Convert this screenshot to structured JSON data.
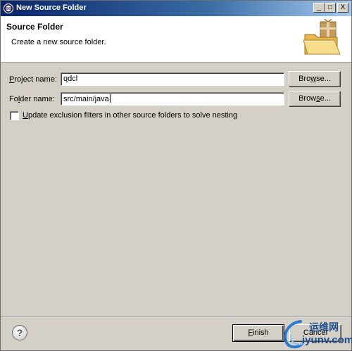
{
  "window": {
    "title": "New Source Folder",
    "controls": {
      "minimize": "_",
      "maximize": "□",
      "close": "X"
    }
  },
  "header": {
    "title": "Source Folder",
    "description": "Create a new source folder.",
    "image_icon": "folder-package-icon"
  },
  "form": {
    "project": {
      "label_underlined": "P",
      "label_rest": "roject name:",
      "value": "qdcl",
      "browse_underlined": "w",
      "browse_before": "Bro",
      "browse_after": "se..."
    },
    "folder": {
      "label_before": "Fo",
      "label_underlined": "l",
      "label_after": "der name:",
      "value": "src/main/java",
      "browse_before": "Brow",
      "browse_underlined": "s",
      "browse_after": "e..."
    },
    "update_exclusion": {
      "checked": false,
      "label_underlined": "U",
      "label_rest": "pdate exclusion filters in other source folders to solve nesting"
    }
  },
  "footer": {
    "help_symbol": "?",
    "finish_underlined": "F",
    "finish_rest": "inish",
    "cancel_label": "Cancel"
  },
  "watermark": {
    "line1": "运维网",
    "line2": "iyunv.com"
  },
  "colors": {
    "dialog_bg": "#d4d0c8",
    "title_gradient_start": "#0a246a",
    "title_gradient_end": "#a6caf0",
    "watermark": "#1a4e8a"
  }
}
